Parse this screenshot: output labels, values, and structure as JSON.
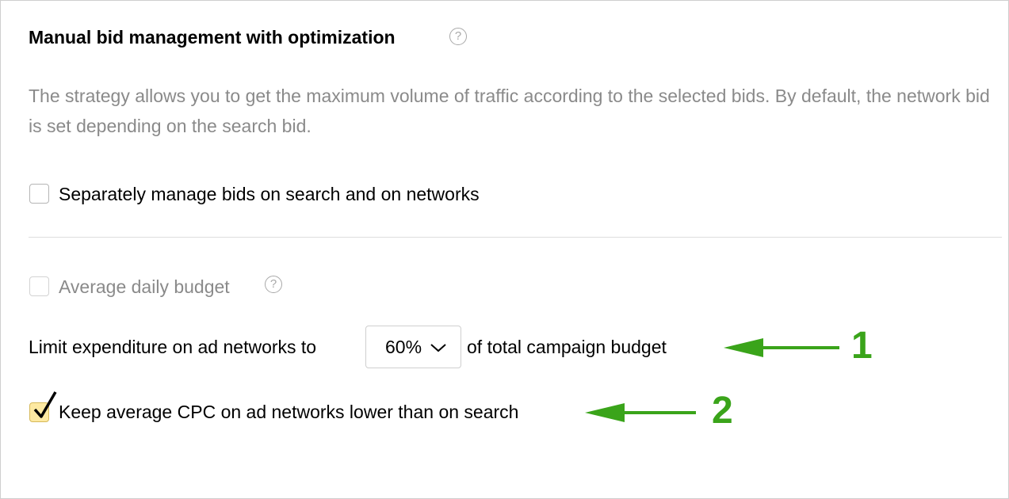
{
  "strategy": {
    "title": "Manual bid management with optimization",
    "help_icon": "question-circle-icon",
    "description": "The strategy allows you to get the maximum volume of traffic according to the selected bids. By default, the network bid is set depending on the search bid."
  },
  "options": {
    "separate_bids": {
      "label": "Separately manage bids on search and on networks",
      "checked": false
    },
    "daily_budget": {
      "label": "Average daily budget",
      "checked": false,
      "disabled": true
    }
  },
  "network_limit": {
    "label_before": "Limit expenditure on ad networks to",
    "selected_value": "60%",
    "label_after": "of total campaign budget"
  },
  "keep_cpc": {
    "label": "Keep average CPC on ad networks lower than on search",
    "checked": true
  },
  "annotations": {
    "arrow_1": "1",
    "arrow_2": "2",
    "color": "#3aa41a"
  },
  "colors": {
    "checked_fill": "#fde9a2",
    "muted_text": "#8a8a8a"
  }
}
